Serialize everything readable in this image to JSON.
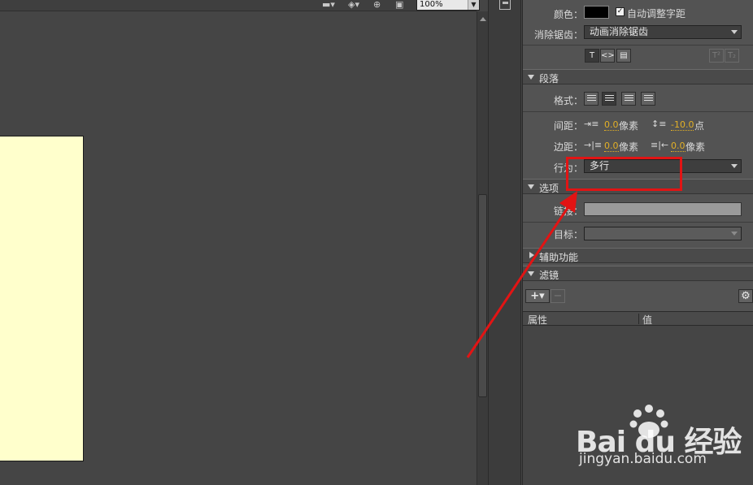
{
  "stage": {
    "zoom_value": "100%"
  },
  "panel": {
    "color_label": "颜色：",
    "color_value": "#000000",
    "auto_kern_checked": true,
    "auto_kern_label": "自动调整字距",
    "anti_alias_label": "消除锯齿：",
    "anti_alias_value": "动画消除锯齿",
    "paragraph": {
      "title": "段落",
      "format_label": "格式：",
      "spacing_label": "间距：",
      "indent_value": "0.0",
      "indent_unit": "像素",
      "line_spacing_value": "-10.0",
      "line_spacing_unit": "点",
      "margins_label": "边距：",
      "left_margin_value": "0.0",
      "left_margin_unit": "像素",
      "right_margin_value": "0.0",
      "right_margin_unit": "像素",
      "behavior_label": "行为：",
      "behavior_value": "多行"
    },
    "options": {
      "title": "选项",
      "link_label": "链接：",
      "target_label": "目标："
    },
    "accessibility": {
      "title": "辅助功能"
    },
    "filters": {
      "title": "滤镜",
      "col_property": "属性",
      "col_value": "值"
    }
  },
  "watermark": {
    "logo_text": "Bai du 经验",
    "url": "jingyan.baidu.com"
  },
  "colors": {
    "annotation": "#e21414",
    "stage_fill": "#ffffcc",
    "accent_number": "#e3b026"
  }
}
